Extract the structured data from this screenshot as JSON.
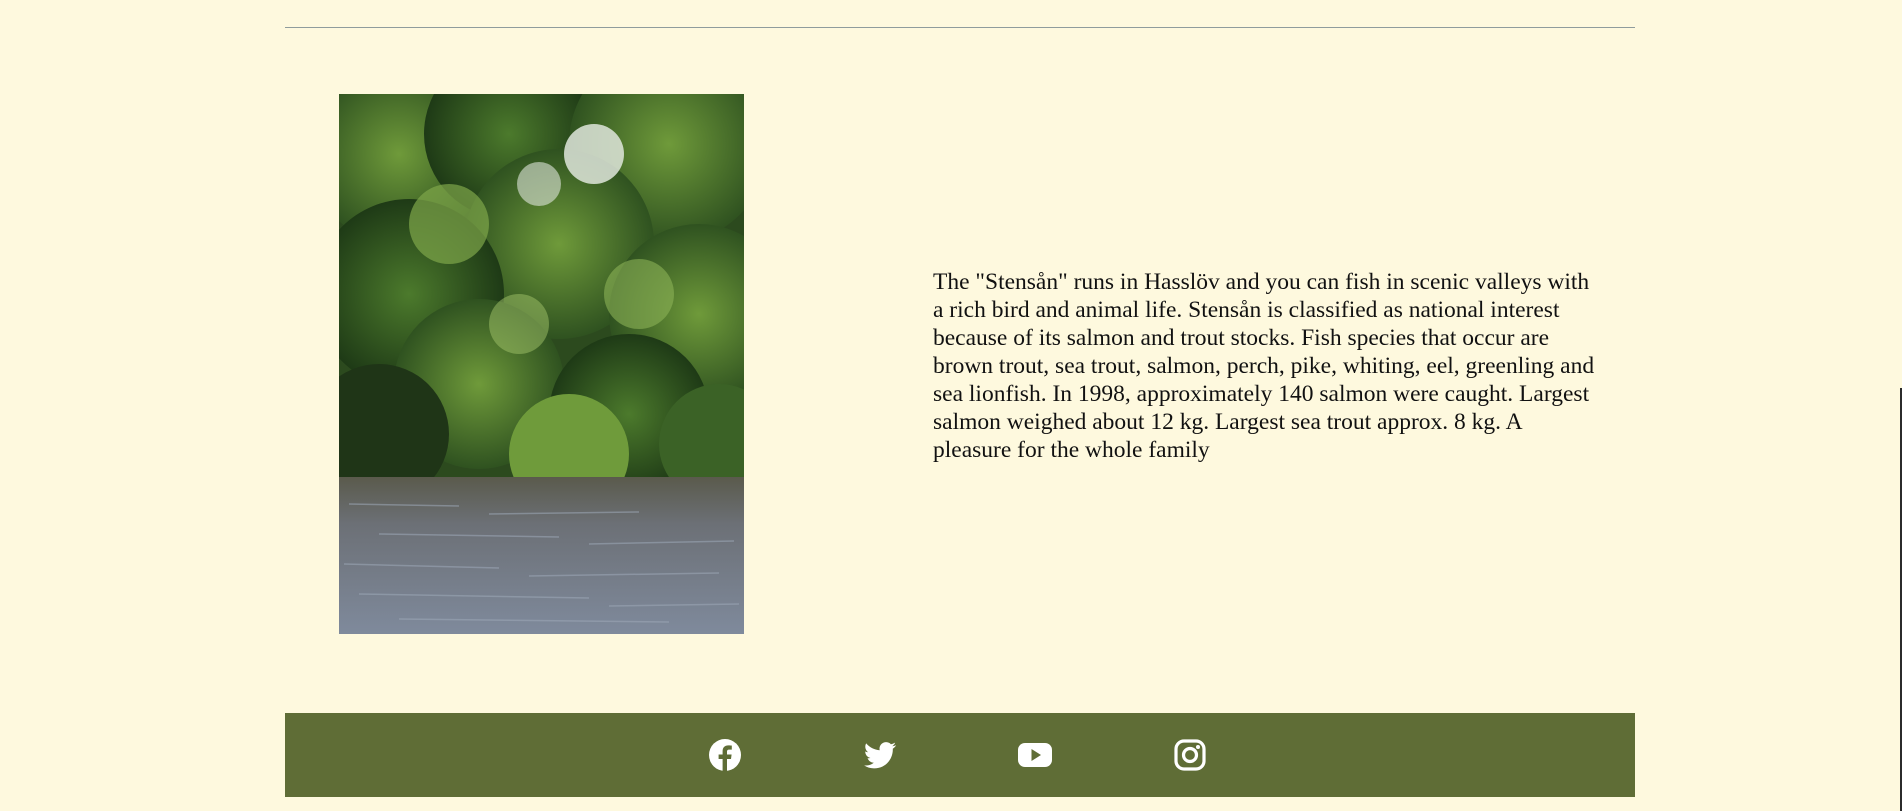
{
  "article": {
    "description": "The \"Stensån\" runs in Hasslöv and you can fish in scenic valleys with a rich bird and animal life. Stensån is classified as national interest because of its salmon and trout stocks. Fish species that occur are brown trout, sea trout, salmon, perch, pike, whiting, eel, greenling and sea lionfish. In 1998, approximately 140 salmon were caught. Largest salmon weighed about 12 kg. Largest sea trout approx. 8 kg. A pleasure for the whole family"
  },
  "footer": {
    "social": [
      {
        "icon": "facebook-icon"
      },
      {
        "icon": "twitter-icon"
      },
      {
        "icon": "youtube-icon"
      },
      {
        "icon": "instagram-icon"
      }
    ]
  },
  "colors": {
    "background": "#fef9de",
    "footer": "#5f6d36",
    "icon": "#ffffff",
    "rule": "#8f9c9c"
  }
}
